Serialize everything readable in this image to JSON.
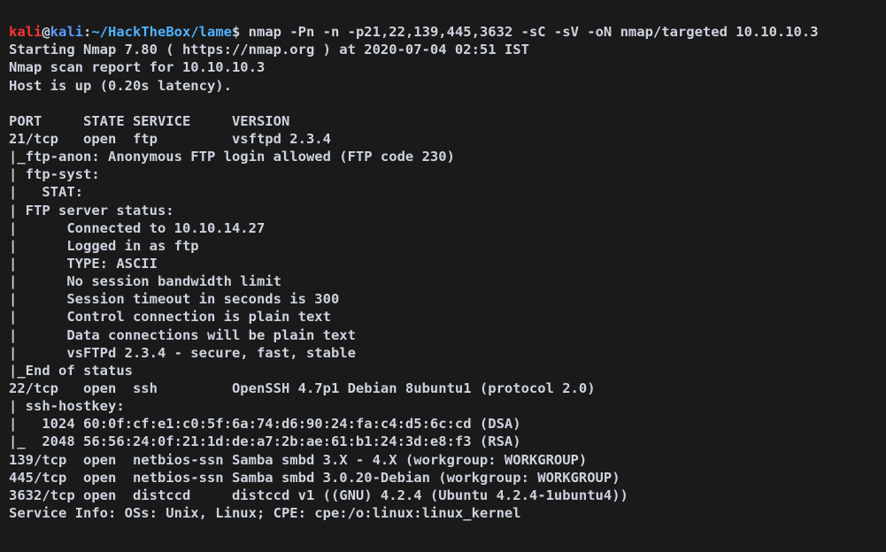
{
  "prompt": {
    "user": "kali",
    "at": "@",
    "host": "kali",
    "sep": ":",
    "path": "~/HackTheBox/lame",
    "dollar": "$",
    "command": " nmap -Pn -n -p21,22,139,445,3632 -sC -sV -oN nmap/targeted 10.10.10.3"
  },
  "lines": {
    "l01": "Starting Nmap 7.80 ( https://nmap.org ) at 2020-07-04 02:51 IST",
    "l02": "Nmap scan report for 10.10.10.3",
    "l03": "Host is up (0.20s latency).",
    "l04": "",
    "l05": "PORT     STATE SERVICE     VERSION",
    "l06": "21/tcp   open  ftp         vsftpd 2.3.4",
    "l07": "|_ftp-anon: Anonymous FTP login allowed (FTP code 230)",
    "l08": "| ftp-syst: ",
    "l09": "|   STAT: ",
    "l10": "| FTP server status:",
    "l11": "|      Connected to 10.10.14.27",
    "l12": "|      Logged in as ftp",
    "l13": "|      TYPE: ASCII",
    "l14": "|      No session bandwidth limit",
    "l15": "|      Session timeout in seconds is 300",
    "l16": "|      Control connection is plain text",
    "l17": "|      Data connections will be plain text",
    "l18": "|      vsFTPd 2.3.4 - secure, fast, stable",
    "l19": "|_End of status",
    "l20": "22/tcp   open  ssh         OpenSSH 4.7p1 Debian 8ubuntu1 (protocol 2.0)",
    "l21": "| ssh-hostkey: ",
    "l22": "|   1024 60:0f:cf:e1:c0:5f:6a:74:d6:90:24:fa:c4:d5:6c:cd (DSA)",
    "l23": "|_  2048 56:56:24:0f:21:1d:de:a7:2b:ae:61:b1:24:3d:e8:f3 (RSA)",
    "l24": "139/tcp  open  netbios-ssn Samba smbd 3.X - 4.X (workgroup: WORKGROUP)",
    "l25": "445/tcp  open  netbios-ssn Samba smbd 3.0.20-Debian (workgroup: WORKGROUP)",
    "l26": "3632/tcp open  distccd     distccd v1 ((GNU) 4.2.4 (Ubuntu 4.2.4-1ubuntu4))",
    "l27": "Service Info: OSs: Unix, Linux; CPE: cpe:/o:linux:linux_kernel"
  }
}
